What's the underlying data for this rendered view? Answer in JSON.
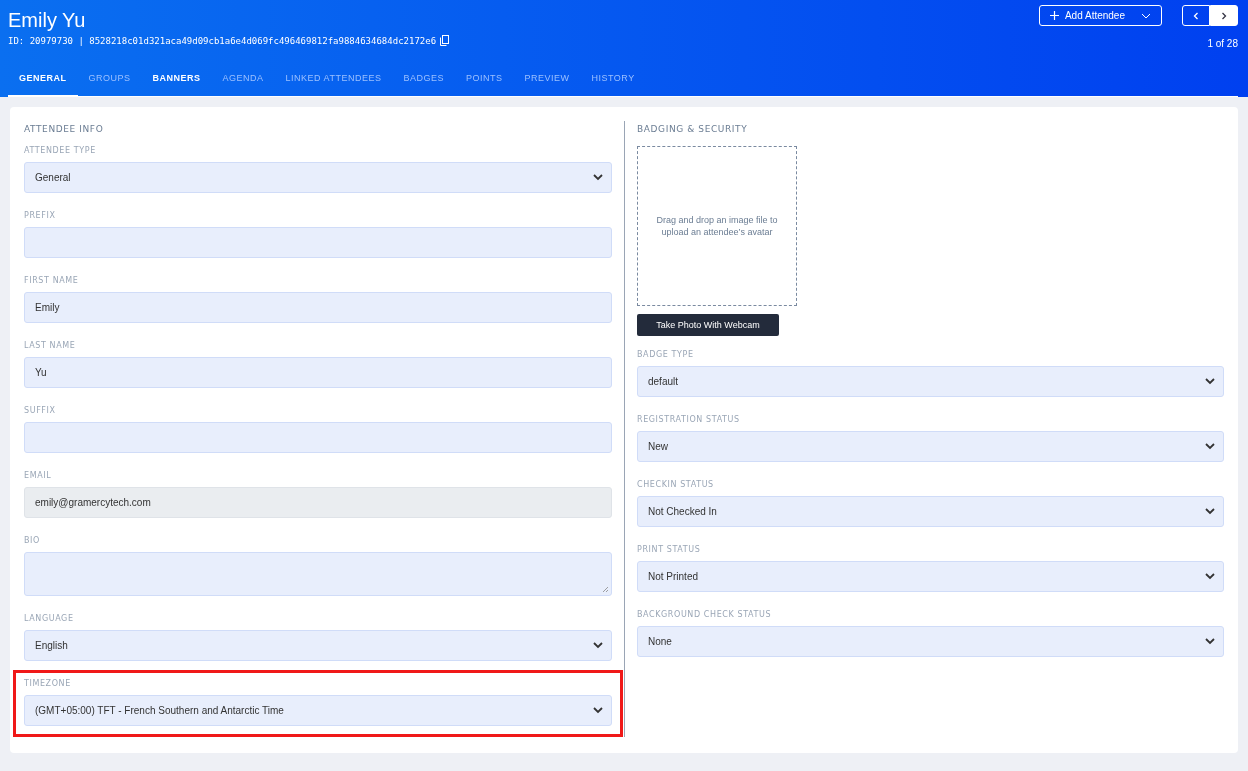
{
  "header": {
    "title": "Emily Yu",
    "id_line": "ID: 20979730 | 8528218c01d321aca49d09cb1a6e4d069fc496469812fa9884634684dc2172e6",
    "add_button": "Add Attendee",
    "pager": "1 of 28"
  },
  "tabs": [
    {
      "label": "GENERAL",
      "selected": true,
      "emphasized": true
    },
    {
      "label": "GROUPS",
      "selected": false,
      "emphasized": false
    },
    {
      "label": "BANNERS",
      "selected": false,
      "emphasized": true
    },
    {
      "label": "AGENDA",
      "selected": false,
      "emphasized": false
    },
    {
      "label": "LINKED ATTENDEES",
      "selected": false,
      "emphasized": false
    },
    {
      "label": "BADGES",
      "selected": false,
      "emphasized": false
    },
    {
      "label": "POINTS",
      "selected": false,
      "emphasized": false
    },
    {
      "label": "PREVIEW",
      "selected": false,
      "emphasized": false
    },
    {
      "label": "HISTORY",
      "selected": false,
      "emphasized": false
    }
  ],
  "attendee_info": {
    "heading": "ATTENDEE INFO",
    "fields": [
      {
        "label": "ATTENDEE TYPE",
        "kind": "select",
        "value": "General",
        "disabled": false
      },
      {
        "label": "PREFIX",
        "kind": "text",
        "disabled": false
      },
      {
        "label": "FIRST NAME",
        "kind": "text",
        "value": "Emily",
        "disabled": false
      },
      {
        "label": "LAST NAME",
        "kind": "text",
        "value": "Yu",
        "disabled": false
      },
      {
        "label": "SUFFIX",
        "kind": "text",
        "disabled": false
      },
      {
        "label": "EMAIL",
        "kind": "text",
        "value": "emily@gramercytech.com",
        "disabled": true
      },
      {
        "label": "BIO",
        "kind": "textarea",
        "disabled": false
      },
      {
        "label": "LANGUAGE",
        "kind": "select",
        "value": "English",
        "disabled": false
      },
      {
        "label": "TIMEZONE",
        "kind": "select",
        "value": "(GMT+05:00) TFT - French Southern and Antarctic Time",
        "disabled": false,
        "highlighted": true
      }
    ]
  },
  "badging_security": {
    "heading": "BADGING & SECURITY",
    "dropzone": "Drag and drop an image file to upload an attendee’s avatar",
    "webcam_button": "Take Photo With Webcam",
    "fields": [
      {
        "label": "BADGE TYPE",
        "kind": "select",
        "value": "default",
        "disabled": false
      },
      {
        "label": "REGISTRATION STATUS",
        "kind": "select",
        "value": "New",
        "disabled": false
      },
      {
        "label": "CHECKIN STATUS",
        "kind": "select",
        "value": "Not Checked In",
        "disabled": false
      },
      {
        "label": "PRINT STATUS",
        "kind": "select",
        "value": "Not Printed",
        "disabled": false
      },
      {
        "label": "BACKGROUND CHECK STATUS",
        "kind": "select",
        "value": "None",
        "disabled": false
      }
    ]
  }
}
